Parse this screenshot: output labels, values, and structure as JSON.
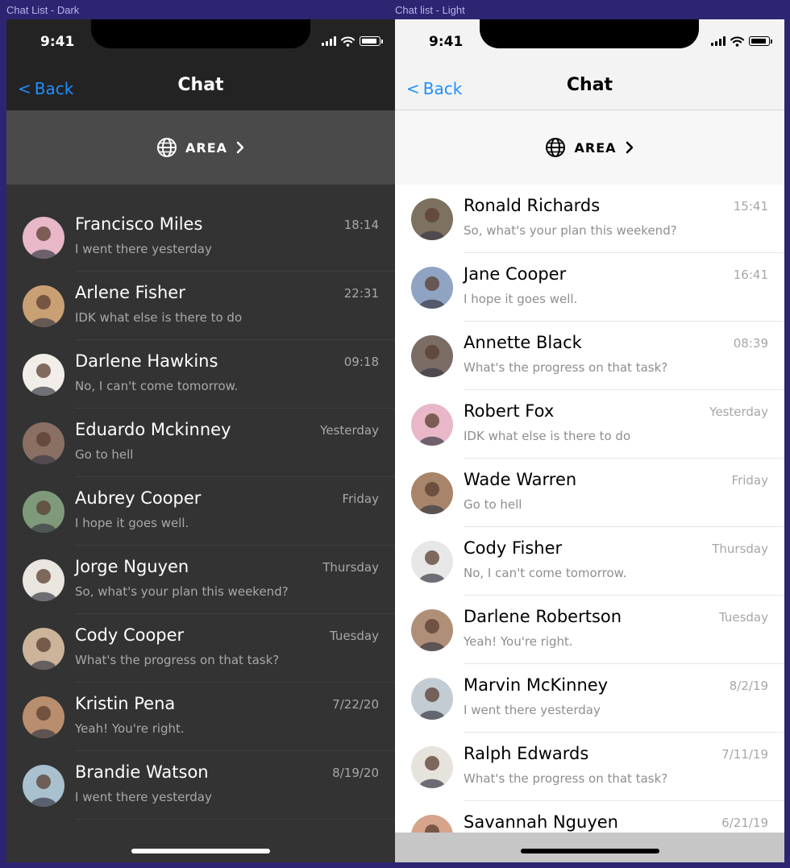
{
  "frames": {
    "dark_label": "Chat List - Dark",
    "light_label": "Chat list - Light"
  },
  "colors": {
    "accent": "#1f8fff",
    "dark_bg": "#333333",
    "light_bg": "#ffffff",
    "canvas": "#2d2572"
  },
  "dark": {
    "status_time": "9:41",
    "back_label": "Back",
    "title": "Chat",
    "area_label": "AREA",
    "chats": [
      {
        "name": "Francisco Miles",
        "message": "I went there yesterday",
        "time": "18:14",
        "avatar_color": "#e8b7c8"
      },
      {
        "name": "Arlene Fisher",
        "message": "IDK what else is there to do",
        "time": "22:31",
        "avatar_color": "#c9a074"
      },
      {
        "name": "Darlene Hawkins",
        "message": "No, I can't come tomorrow.",
        "time": "09:18",
        "avatar_color": "#f1eeea"
      },
      {
        "name": "Eduardo Mckinney",
        "message": "Go to hell",
        "time": "Yesterday",
        "avatar_color": "#8a6f63"
      },
      {
        "name": "Aubrey Cooper",
        "message": "I hope it goes well.",
        "time": "Friday",
        "avatar_color": "#7f9a7a"
      },
      {
        "name": "Jorge Nguyen",
        "message": "So, what's your plan this weekend?",
        "time": "Thursday",
        "avatar_color": "#e9e5df"
      },
      {
        "name": "Cody Cooper",
        "message": "What's the progress on that task?",
        "time": "Tuesday",
        "avatar_color": "#cbb49a"
      },
      {
        "name": "Kristin Pena",
        "message": "Yeah! You're right.",
        "time": "7/22/20",
        "avatar_color": "#b98e6e"
      },
      {
        "name": "Brandie Watson",
        "message": "I went there yesterday",
        "time": "8/19/20",
        "avatar_color": "#a9c0cf"
      }
    ]
  },
  "light": {
    "status_time": "9:41",
    "back_label": "Back",
    "title": "Chat",
    "area_label": "AREA",
    "chats": [
      {
        "name": "Ronald Richards",
        "message": "So, what's your plan this weekend?",
        "time": "15:41",
        "avatar_color": "#7d715f"
      },
      {
        "name": "Jane Cooper",
        "message": "I hope it goes well.",
        "time": "16:41",
        "avatar_color": "#8fa3c2"
      },
      {
        "name": "Annette Black",
        "message": "What's the progress on that task?",
        "time": "08:39",
        "avatar_color": "#7b6c66"
      },
      {
        "name": "Robert Fox",
        "message": "IDK what else is there to do",
        "time": "Yesterday",
        "avatar_color": "#e8b7c8"
      },
      {
        "name": "Wade Warren",
        "message": "Go to hell",
        "time": "Friday",
        "avatar_color": "#a8856a"
      },
      {
        "name": "Cody Fisher",
        "message": "No, I can't come tomorrow.",
        "time": "Thursday",
        "avatar_color": "#e7e7e7"
      },
      {
        "name": "Darlene Robertson",
        "message": "Yeah! You're right.",
        "time": "Tuesday",
        "avatar_color": "#b08f78"
      },
      {
        "name": "Marvin McKinney",
        "message": "I went there yesterday",
        "time": "8/2/19",
        "avatar_color": "#c3ccd3"
      },
      {
        "name": "Ralph Edwards",
        "message": "What's the progress on that task?",
        "time": "7/11/19",
        "avatar_color": "#e6e2dc"
      },
      {
        "name": "Savannah Nguyen",
        "message": "",
        "time": "6/21/19",
        "avatar_color": "#d5a48a"
      }
    ]
  }
}
